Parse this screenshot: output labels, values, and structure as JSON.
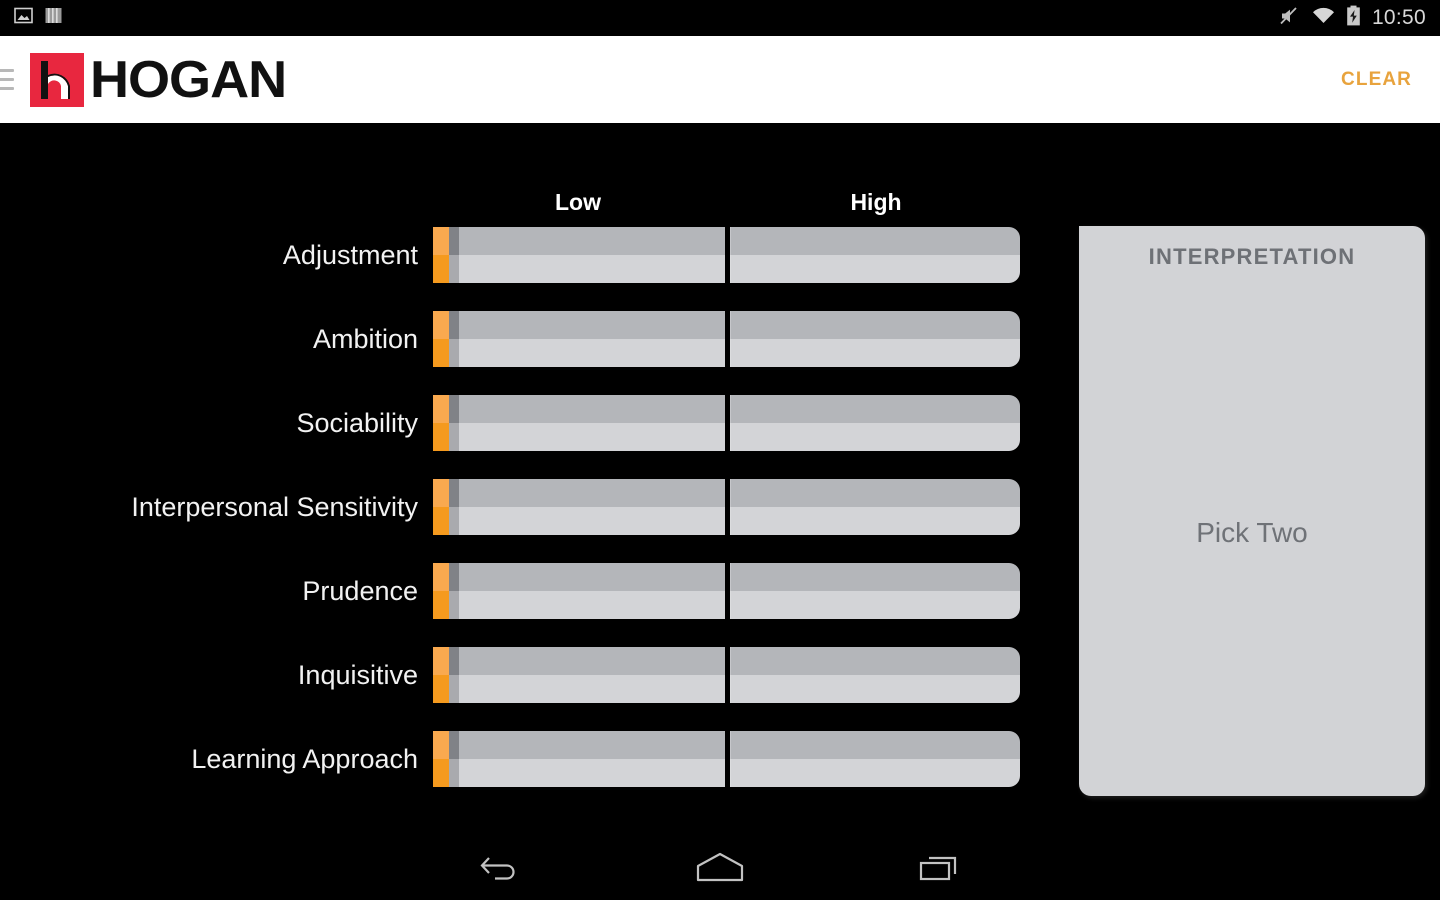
{
  "status_bar": {
    "time": "10:50",
    "left_icons": [
      "screenshot-image-icon",
      "bars-icon"
    ],
    "right_icons": [
      "volume-muted-icon",
      "wifi-icon",
      "battery-charging-icon"
    ]
  },
  "app_bar": {
    "menu_icon": "hamburger-menu-icon",
    "logo_mark": "hogan-h-logo-icon",
    "brand": "HOGAN",
    "clear_label": "CLEAR",
    "clear_color": "#E8A33D",
    "brand_red": "#E8273F"
  },
  "main": {
    "columns": [
      {
        "key": "low",
        "label": "Low"
      },
      {
        "key": "high",
        "label": "High"
      }
    ],
    "scales": [
      {
        "label": "Adjustment",
        "low_selected": false,
        "high_selected": false
      },
      {
        "label": "Ambition",
        "low_selected": false,
        "high_selected": false
      },
      {
        "label": "Sociability",
        "low_selected": false,
        "high_selected": false
      },
      {
        "label": "Interpersonal Sensitivity",
        "low_selected": false,
        "high_selected": false
      },
      {
        "label": "Prudence",
        "low_selected": false,
        "high_selected": false
      },
      {
        "label": "Inquisitive",
        "low_selected": false,
        "high_selected": false
      },
      {
        "label": "Learning Approach",
        "low_selected": false,
        "high_selected": false
      }
    ],
    "marker_color_top": "#F9A94F",
    "marker_color_bottom": "#F59A1E",
    "bar_color_top": "#B4B6BA",
    "bar_color_bottom": "#D3D4D7"
  },
  "interpretation": {
    "title": "INTERPRETATION",
    "message": "Pick Two"
  },
  "nav_bar": {
    "back": "back-icon",
    "home": "home-icon",
    "recents": "recents-icon"
  }
}
